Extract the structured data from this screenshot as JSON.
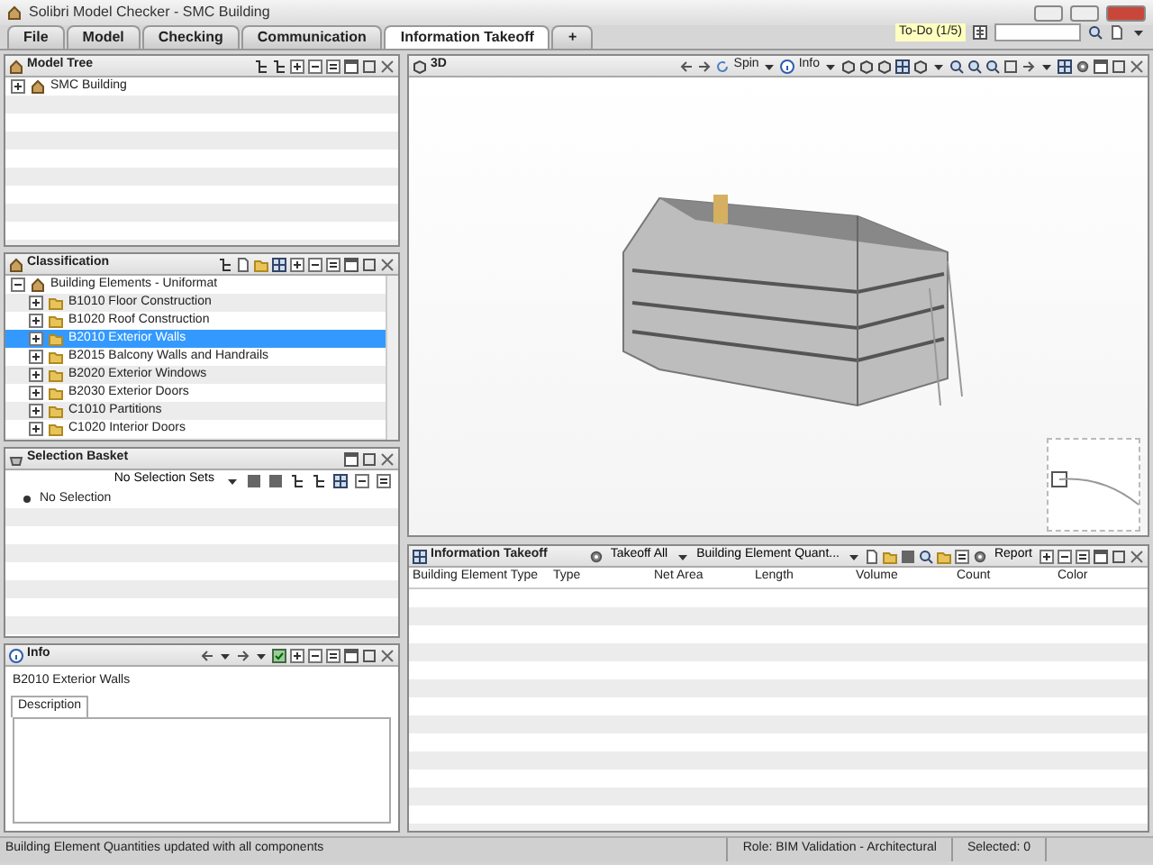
{
  "window": {
    "title": "Solibri Model Checker - SMC Building"
  },
  "tabs": [
    {
      "label": "File",
      "selected": false
    },
    {
      "label": "Model",
      "selected": false
    },
    {
      "label": "Checking",
      "selected": false
    },
    {
      "label": "Communication",
      "selected": false
    },
    {
      "label": "Information Takeoff",
      "selected": true
    },
    {
      "label": "+",
      "selected": false
    }
  ],
  "todo": {
    "label": "To-Do (1/5)"
  },
  "model_tree": {
    "title": "Model Tree",
    "items": [
      {
        "label": "SMC Building",
        "expanded": false
      }
    ]
  },
  "classification": {
    "title": "Classification",
    "root": {
      "label": "Building Elements - Uniformat",
      "expanded": true,
      "children": [
        {
          "label": "B1010 Floor Construction",
          "selected": false
        },
        {
          "label": "B1020 Roof Construction",
          "selected": false
        },
        {
          "label": "B2010 Exterior Walls",
          "selected": true
        },
        {
          "label": "B2015 Balcony Walls and Handrails",
          "selected": false
        },
        {
          "label": "B2020 Exterior Windows",
          "selected": false
        },
        {
          "label": "B2030 Exterior Doors",
          "selected": false
        },
        {
          "label": "C1010 Partitions",
          "selected": false
        },
        {
          "label": "C1020 Interior Doors",
          "selected": false
        }
      ]
    }
  },
  "selection_basket": {
    "title": "Selection Basket",
    "sets_label": "No Selection Sets",
    "items": [
      {
        "label": "No Selection"
      }
    ]
  },
  "info": {
    "title": "Info",
    "subject": "B2010 Exterior Walls",
    "tabs": [
      {
        "label": "Description",
        "selected": true
      }
    ]
  },
  "view_3d": {
    "title": "3D",
    "spin": "Spin",
    "info": "Info"
  },
  "takeoff": {
    "title": "Information Takeoff",
    "takeoff_all": "Takeoff All",
    "template": "Building Element Quant...",
    "report": "Report",
    "columns": [
      "Building Element Type",
      "Type",
      "Net Area",
      "Length",
      "Volume",
      "Count",
      "Color"
    ]
  },
  "status_bar": {
    "message": "Building Element Quantities updated with all components",
    "role": "Role: BIM Validation - Architectural",
    "selected": "Selected: 0"
  }
}
